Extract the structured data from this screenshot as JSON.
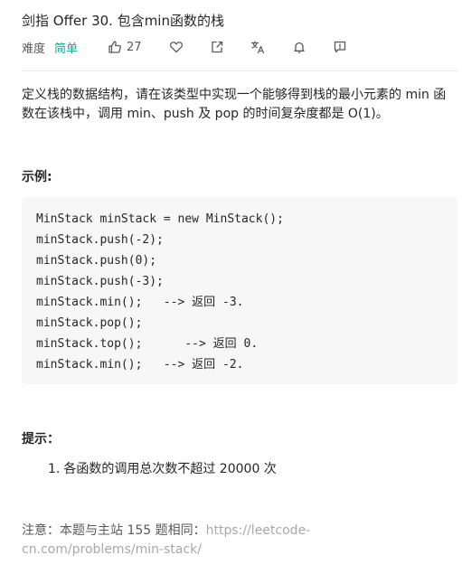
{
  "problem": {
    "title": "剑指 Offer 30. 包含min函数的栈",
    "difficulty_label": "难度",
    "difficulty": "简单",
    "likes": "27",
    "description": "定义栈的数据结构，请在该类型中实现一个能够得到栈的最小元素的 min 函数在该栈中，调用 min、push 及 pop 的时间复杂度都是 O(1)。",
    "example_heading": "示例:",
    "code_lines": [
      "MinStack minStack = new MinStack();",
      "minStack.push(-2);",
      "minStack.push(0);",
      "minStack.push(-3);",
      "minStack.min();   --> 返回 -3.",
      "minStack.pop();",
      "minStack.top();      --> 返回 0.",
      "minStack.min();   --> 返回 -2."
    ],
    "tips_heading": "提示：",
    "tips": [
      {
        "num": "1.",
        "text": "各函数的调用总次数不超过 20000 次"
      }
    ],
    "note_prefix": "注意：本题与主站 155 题相同：",
    "note_link": "https://leetcode-cn.com/problems/min-stack/"
  },
  "icons": {
    "like": "thumbs-up-icon",
    "favorite": "heart-icon",
    "share": "share-icon",
    "translate": "translate-icon",
    "notify": "bell-icon",
    "feedback": "feedback-icon"
  },
  "colors": {
    "difficulty_easy": "#00af9b",
    "link": "#a8a8a8",
    "code_bg": "#f7f7f8"
  }
}
